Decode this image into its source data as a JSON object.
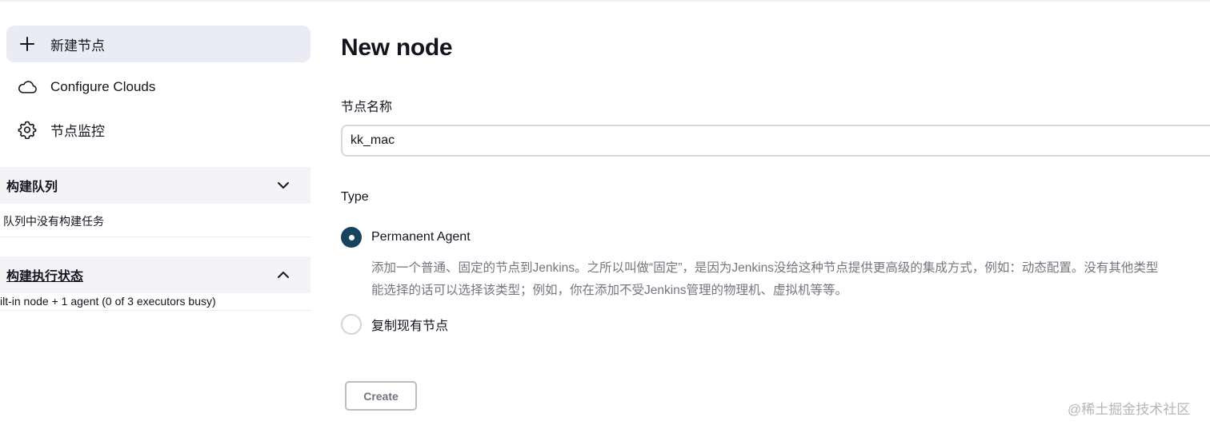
{
  "sidebar": {
    "items": [
      {
        "label": "新建节点",
        "icon": "plus-icon",
        "active": true
      },
      {
        "label": "Configure Clouds",
        "icon": "cloud-icon",
        "active": false
      },
      {
        "label": "节点监控",
        "icon": "gear-icon",
        "active": false
      }
    ],
    "build_queue": {
      "title": "构建队列",
      "state": "collapsed",
      "chevron_icon": "chevron-down-icon",
      "body": "队列中没有构建任务"
    },
    "executor_status": {
      "title": "构建执行状态",
      "state": "expanded",
      "chevron_icon": "chevron-up-icon",
      "body": "ilt-in node + 1 agent (0 of 3 executors busy)"
    }
  },
  "main": {
    "title": "New node",
    "node_name_label": "节点名称",
    "node_name_value": "kk_mac",
    "type_label": "Type",
    "options": [
      {
        "label": "Permanent Agent",
        "checked": true,
        "description": [
          "添加一个普通、固定的节点到Jenkins。之所以叫做“固定”，是因为Jenkins没给这种节点提供更高级的集成方式，例如：动态配置。没有其他类型",
          "能选择的话可以选择该类型；例如，你在添加不受Jenkins管理的物理机、虚拟机等等。"
        ]
      },
      {
        "label": "复制现有节点",
        "checked": false
      }
    ],
    "create_label": "Create"
  },
  "watermark": "@稀土掘金技术社区",
  "colors": {
    "accent": "#17435f",
    "active_bg": "#ebebf5",
    "panel_bg": "#f4f4f6",
    "muted_text": "#75757f"
  }
}
